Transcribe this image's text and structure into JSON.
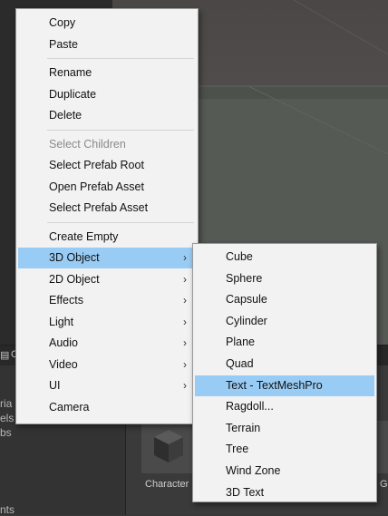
{
  "context_menu": {
    "groups": [
      [
        {
          "label": "Copy"
        },
        {
          "label": "Paste"
        }
      ],
      [
        {
          "label": "Rename"
        },
        {
          "label": "Duplicate"
        },
        {
          "label": "Delete"
        }
      ],
      [
        {
          "label": "Select Children",
          "disabled": true
        },
        {
          "label": "Select Prefab Root"
        },
        {
          "label": "Open Prefab Asset"
        },
        {
          "label": "Select Prefab Asset"
        }
      ],
      [
        {
          "label": "Create Empty"
        },
        {
          "label": "3D Object",
          "submenu": true,
          "active": true
        },
        {
          "label": "2D Object",
          "submenu": true
        },
        {
          "label": "Effects",
          "submenu": true
        },
        {
          "label": "Light",
          "submenu": true
        },
        {
          "label": "Audio",
          "submenu": true
        },
        {
          "label": "Video",
          "submenu": true
        },
        {
          "label": "UI",
          "submenu": true
        },
        {
          "label": "Camera"
        }
      ]
    ],
    "submenu_arrow": "›"
  },
  "submenu_3d_object": {
    "items": [
      {
        "label": "Cube"
      },
      {
        "label": "Sphere"
      },
      {
        "label": "Capsule"
      },
      {
        "label": "Cylinder"
      },
      {
        "label": "Plane"
      },
      {
        "label": "Quad"
      },
      {
        "label": "Text - TextMeshPro",
        "highlighted": true
      },
      {
        "label": "Ragdoll..."
      },
      {
        "label": "Terrain"
      },
      {
        "label": "Tree"
      },
      {
        "label": "Wind Zone"
      },
      {
        "label": "3D Text"
      }
    ]
  },
  "background": {
    "tab_partial": "C",
    "tree_partial": [
      "ria",
      "els",
      "bs",
      "nts"
    ],
    "asset_left_partial": "Character",
    "asset_right_partial": "G"
  },
  "colors": {
    "menu_bg": "#f2f2f2",
    "highlight": "#99ccf5"
  }
}
